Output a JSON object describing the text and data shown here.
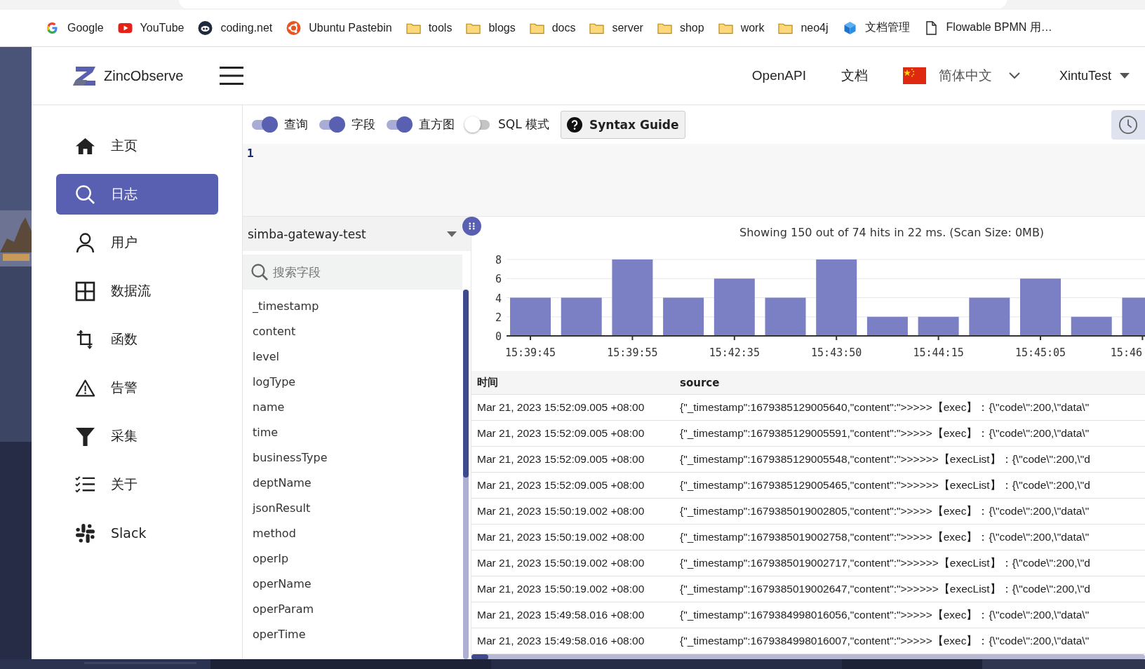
{
  "bookmarks": [
    {
      "label": "Google",
      "kind": "google"
    },
    {
      "label": "YouTube",
      "kind": "youtube"
    },
    {
      "label": "coding.net",
      "kind": "coding"
    },
    {
      "label": "Ubuntu Pastebin",
      "kind": "ubuntu"
    },
    {
      "label": "tools",
      "kind": "folder"
    },
    {
      "label": "blogs",
      "kind": "folder"
    },
    {
      "label": "docs",
      "kind": "folder"
    },
    {
      "label": "server",
      "kind": "folder"
    },
    {
      "label": "shop",
      "kind": "folder"
    },
    {
      "label": "work",
      "kind": "folder"
    },
    {
      "label": "neo4j",
      "kind": "folder"
    },
    {
      "label": "文档管理",
      "kind": "cube"
    },
    {
      "label": "Flowable BPMN 用…",
      "kind": "file"
    }
  ],
  "header": {
    "brand": "ZincObserve",
    "links": [
      "OpenAPI",
      "文档"
    ],
    "language": "简体中文",
    "user": "XintuTest"
  },
  "sidebar": {
    "items": [
      {
        "label": "主页",
        "kind": "home",
        "selected": false
      },
      {
        "label": "日志",
        "kind": "search",
        "selected": true
      },
      {
        "label": "用户",
        "kind": "user",
        "selected": false
      },
      {
        "label": "数据流",
        "kind": "grid",
        "selected": false
      },
      {
        "label": "函数",
        "kind": "crop",
        "selected": false
      },
      {
        "label": "告警",
        "kind": "warning",
        "selected": false
      },
      {
        "label": "采集",
        "kind": "funnel",
        "selected": false
      },
      {
        "label": "关于",
        "kind": "checklist",
        "selected": false
      },
      {
        "label": "Slack",
        "kind": "slack",
        "selected": false
      }
    ]
  },
  "toolbar": {
    "toggles": [
      {
        "label": "查询",
        "on": true
      },
      {
        "label": "字段",
        "on": true
      },
      {
        "label": "直方图",
        "on": true
      },
      {
        "label": "SQL 模式",
        "on": false
      }
    ],
    "guide_button": "Syntax Guide"
  },
  "editor": {
    "line_numbers": [
      "1"
    ]
  },
  "fields": {
    "stream": "simba-gateway-test",
    "search": {
      "placeholder": "搜索字段"
    },
    "items": [
      "_timestamp",
      "content",
      "level",
      "logType",
      "name",
      "time",
      "businessType",
      "deptName",
      "jsonResult",
      "method",
      "operIp",
      "operName",
      "operParam",
      "operTime"
    ]
  },
  "results": {
    "summary": "Showing 150 out of 74 hits in 22 ms. (Scan Size: 0MB)",
    "chart_data": {
      "type": "bar",
      "categories": [
        "15:39:45",
        null,
        "15:39:55",
        null,
        "15:42:35",
        null,
        "15:43:50",
        null,
        "15:44:15",
        null,
        "15:45:05",
        null,
        "15:46"
      ],
      "values": [
        4,
        4,
        8,
        4,
        6,
        4,
        8,
        2,
        2,
        4,
        6,
        2,
        4
      ],
      "ylim": [
        0,
        8
      ],
      "yticks": [
        0,
        2,
        4,
        6,
        8
      ],
      "grid": true
    },
    "table": {
      "columns": [
        "时间",
        "source"
      ],
      "rows": [
        [
          "Mar 21, 2023 15:52:09.005 +08:00",
          "{\"_timestamp\":1679385129005640,\"content\":\">>>>>【exec】：{\\\"code\\\":200,\\\"data\\\""
        ],
        [
          "Mar 21, 2023 15:52:09.005 +08:00",
          "{\"_timestamp\":1679385129005591,\"content\":\">>>>>【exec】：{\\\"code\\\":200,\\\"data\\\""
        ],
        [
          "Mar 21, 2023 15:52:09.005 +08:00",
          "{\"_timestamp\":1679385129005548,\"content\":\">>>>>>【execList】：{\\\"code\\\":200,\\\"d"
        ],
        [
          "Mar 21, 2023 15:52:09.005 +08:00",
          "{\"_timestamp\":1679385129005465,\"content\":\">>>>>>【execList】：{\\\"code\\\":200,\\\"d"
        ],
        [
          "Mar 21, 2023 15:50:19.002 +08:00",
          "{\"_timestamp\":1679385019002805,\"content\":\">>>>>【exec】：{\\\"code\\\":200,\\\"data\\\""
        ],
        [
          "Mar 21, 2023 15:50:19.002 +08:00",
          "{\"_timestamp\":1679385019002758,\"content\":\">>>>>【exec】：{\\\"code\\\":200,\\\"data\\\""
        ],
        [
          "Mar 21, 2023 15:50:19.002 +08:00",
          "{\"_timestamp\":1679385019002717,\"content\":\">>>>>>【execList】：{\\\"code\\\":200,\\\"d"
        ],
        [
          "Mar 21, 2023 15:50:19.002 +08:00",
          "{\"_timestamp\":1679385019002647,\"content\":\">>>>>>【execList】：{\\\"code\\\":200,\\\"d"
        ],
        [
          "Mar 21, 2023 15:49:58.016 +08:00",
          "{\"_timestamp\":1679384998016056,\"content\":\">>>>>【exec】：{\\\"code\\\":200,\\\"data\\\""
        ],
        [
          "Mar 21, 2023 15:49:58.016 +08:00",
          "{\"_timestamp\":1679384998016007,\"content\":\">>>>>【exec】：{\\\"code\\\":200,\\\"data\\\""
        ]
      ]
    }
  }
}
